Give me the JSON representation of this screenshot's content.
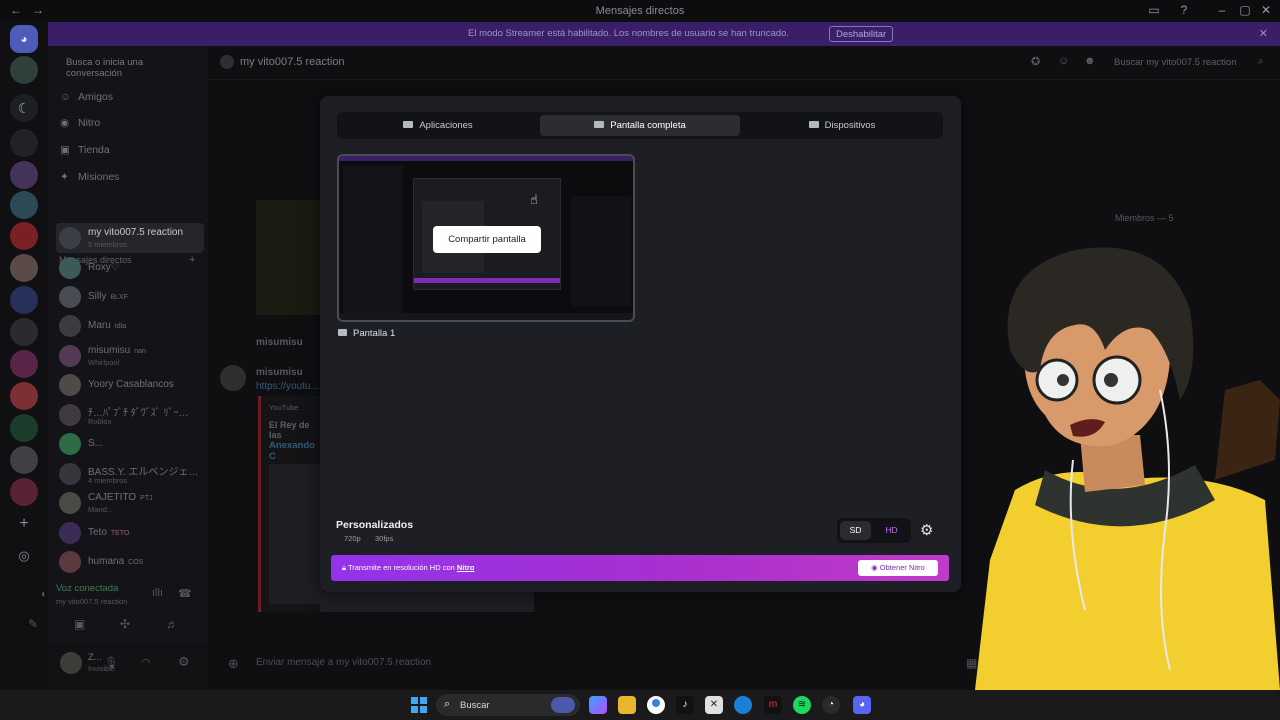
{
  "window": {
    "title": "Mensajes directos"
  },
  "banner": {
    "message": "El modo Streamer está habilitado. Los nombres de usuario se han truncado.",
    "button": "Deshabilitar"
  },
  "sidebar": {
    "search_placeholder": "Busca o inicia una conversación",
    "nav": [
      {
        "label": "Amigos"
      },
      {
        "label": "Nitro"
      },
      {
        "label": "Tienda"
      },
      {
        "label": "Misiones"
      }
    ],
    "dm_header": "Mensajes directos",
    "dms": [
      {
        "name": "my vito007.5 reaction",
        "sub": "5 miembros",
        "tag": ""
      },
      {
        "name": "Roxy♡",
        "sub": "",
        "tag": ""
      },
      {
        "name": "Silly",
        "sub": "",
        "tag": "BLXF"
      },
      {
        "name": "Maru",
        "sub": "",
        "tag": "Idla"
      },
      {
        "name": "misumisu",
        "sub": "Whirlpool",
        "tag": "nan"
      },
      {
        "name": "Yoory Casablancos",
        "sub": "",
        "tag": ""
      },
      {
        "name": "ﾁ…ﾊﾟﾌﾞﾁ ﾀﾞﾜﾞｽﾞ ﾘﾞｰ…",
        "sub": "Roblox",
        "tag": ""
      },
      {
        "name": "S...",
        "sub": "",
        "tag": ""
      },
      {
        "name": "BASS.Y. エルベンジェ…",
        "sub": "4 miembros",
        "tag": ""
      },
      {
        "name": "CAJETITO",
        "sub": "Mand...",
        "tag": "PTJ"
      },
      {
        "name": "Teto",
        "sub": "",
        "tag": "TETO"
      },
      {
        "name": "humana",
        "sub": "",
        "tag": "COS"
      }
    ],
    "voice": {
      "status": "Voz conectada",
      "channel": "my vito007.5 reaction"
    },
    "user": {
      "name": "Z...",
      "status": "Invisible"
    }
  },
  "chat": {
    "channel_name": "my vito007.5 reaction",
    "search_placeholder": "Buscar my vito007.5 reaction",
    "members_header": "Miembros — 5",
    "message_author": "misumisu",
    "embed_source": "YouTube",
    "embed_title": "El Rey de las",
    "embed_link": "Anexando C",
    "link_text": "https://youtu...",
    "input_placeholder": "Enviar mensaje a my vito007.5 reaction"
  },
  "modal": {
    "tabs": [
      {
        "label": "Aplicaciones",
        "active": false
      },
      {
        "label": "Pantalla completa",
        "active": true
      },
      {
        "label": "Dispositivos",
        "active": false
      }
    ],
    "share_button": "Compartir pantalla",
    "screen_label": "Pantalla 1",
    "preset_title": "Personalizados",
    "resolution": "720p",
    "framerate": "30fps",
    "quality_sd": "SD",
    "quality_hd": "HD",
    "nitro_text": "Transmite en resolución HD con",
    "nitro_link": "Nitro",
    "nitro_button": "Obtener Nitro"
  },
  "taskbar": {
    "search_label": "Buscar"
  },
  "colors": {
    "accent": "#5865f2",
    "nitro_gradient_start": "#9333ea",
    "nitro_gradient_end": "#c13ac9",
    "banner_bg": "#3a1f68",
    "modal_bg": "#1e1f24"
  }
}
